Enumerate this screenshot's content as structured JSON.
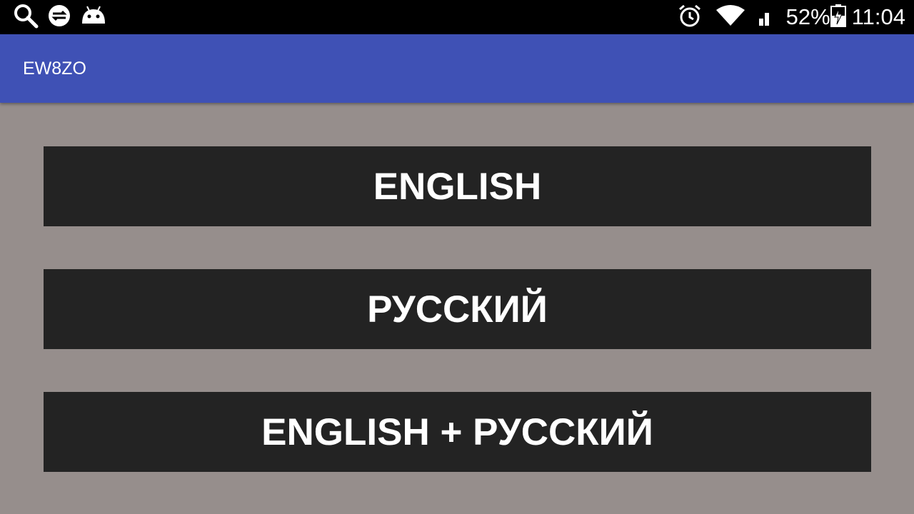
{
  "status_bar": {
    "left_icons": [
      "search-icon",
      "sync-icon",
      "android-icon"
    ],
    "right_icons": [
      "alarm-icon",
      "wifi-icon",
      "signal-icon",
      "battery-charging-icon"
    ],
    "battery": "52%",
    "time": "11:04"
  },
  "app_bar": {
    "title": "EW8ZO",
    "color": "#3f51b5"
  },
  "buttons": [
    {
      "label": "ENGLISH"
    },
    {
      "label": "РУССКИЙ"
    },
    {
      "label": "ENGLISH + РУССКИЙ"
    }
  ],
  "colors": {
    "background": "#968e8c",
    "button": "#232323",
    "status_bar": "#000000"
  }
}
